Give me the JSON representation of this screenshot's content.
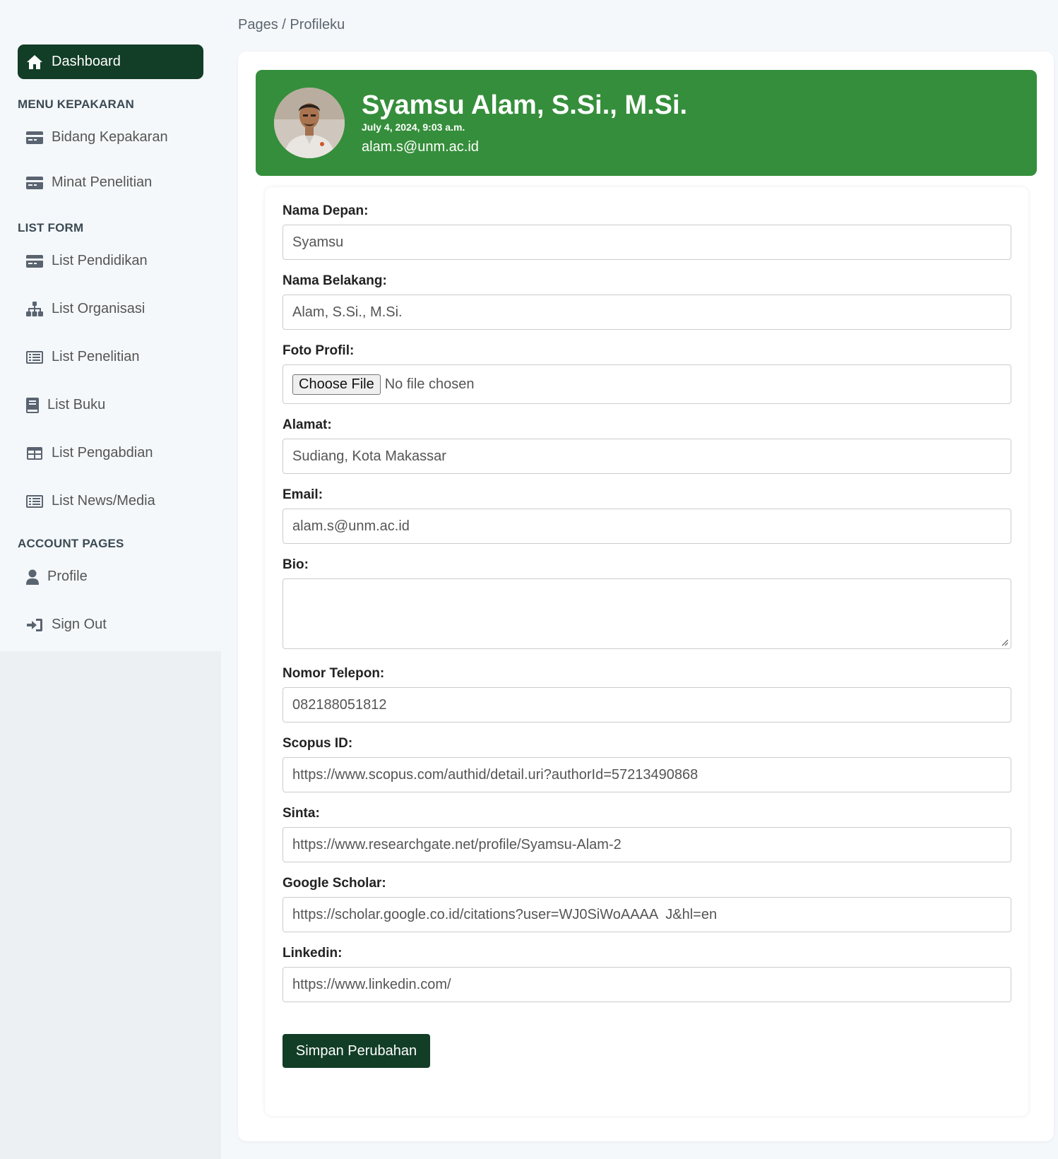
{
  "sidebar": {
    "dashboard_label": "Dashboard",
    "sections": [
      {
        "title": "MENU KEPAKARAN"
      },
      {
        "title": "LIST FORM"
      },
      {
        "title": "ACCOUNT PAGES"
      }
    ],
    "items": [
      {
        "label": "Bidang Kepakaran",
        "icon": "card-icon"
      },
      {
        "label": "Minat Penelitian",
        "icon": "card-icon"
      },
      {
        "label": "List Pendidikan",
        "icon": "card-icon"
      },
      {
        "label": "List Organisasi",
        "icon": "sitemap-icon"
      },
      {
        "label": "List Penelitian",
        "icon": "list-alt-icon"
      },
      {
        "label": "List Buku",
        "icon": "book-icon"
      },
      {
        "label": "List Pengabdian",
        "icon": "table-icon"
      },
      {
        "label": "List News/Media",
        "icon": "list-alt-icon"
      },
      {
        "label": "Profile",
        "icon": "user-icon"
      },
      {
        "label": "Sign Out",
        "icon": "sign-in-icon"
      }
    ]
  },
  "breadcrumb": "Pages / Profileku",
  "header": {
    "name": "Syamsu Alam, S.Si., M.Si.",
    "date": "July 4, 2024, 9:03 a.m.",
    "email": "alam.s@unm.ac.id"
  },
  "form": {
    "nama_depan": {
      "label": "Nama Depan:",
      "value": "Syamsu"
    },
    "nama_belakang": {
      "label": "Nama Belakang:",
      "value": "Alam, S.Si., M.Si."
    },
    "foto_profil": {
      "label": "Foto Profil:",
      "button": "Choose File",
      "status": "No file chosen"
    },
    "alamat": {
      "label": "Alamat:",
      "value": "Sudiang, Kota Makassar"
    },
    "email": {
      "label": "Email:",
      "value": "alam.s@unm.ac.id"
    },
    "bio": {
      "label": "Bio:",
      "value": ""
    },
    "telepon": {
      "label": "Nomor Telepon:",
      "value": "082188051812"
    },
    "scopus": {
      "label": "Scopus ID:",
      "value": "https://www.scopus.com/authid/detail.uri?authorId=57213490868"
    },
    "sinta": {
      "label": "Sinta:",
      "value": "https://www.researchgate.net/profile/Syamsu-Alam-2"
    },
    "scholar": {
      "label": "Google Scholar:",
      "value": "https://scholar.google.co.id/citations?user=WJ0SiWoAAAA  J&hl=en"
    },
    "linkedin": {
      "label": "Linkedin:",
      "value": "https://www.linkedin.com/"
    },
    "submit_label": "Simpan Perubahan"
  },
  "colors": {
    "primary_dark": "#123d26",
    "banner_green": "#358e3b"
  }
}
